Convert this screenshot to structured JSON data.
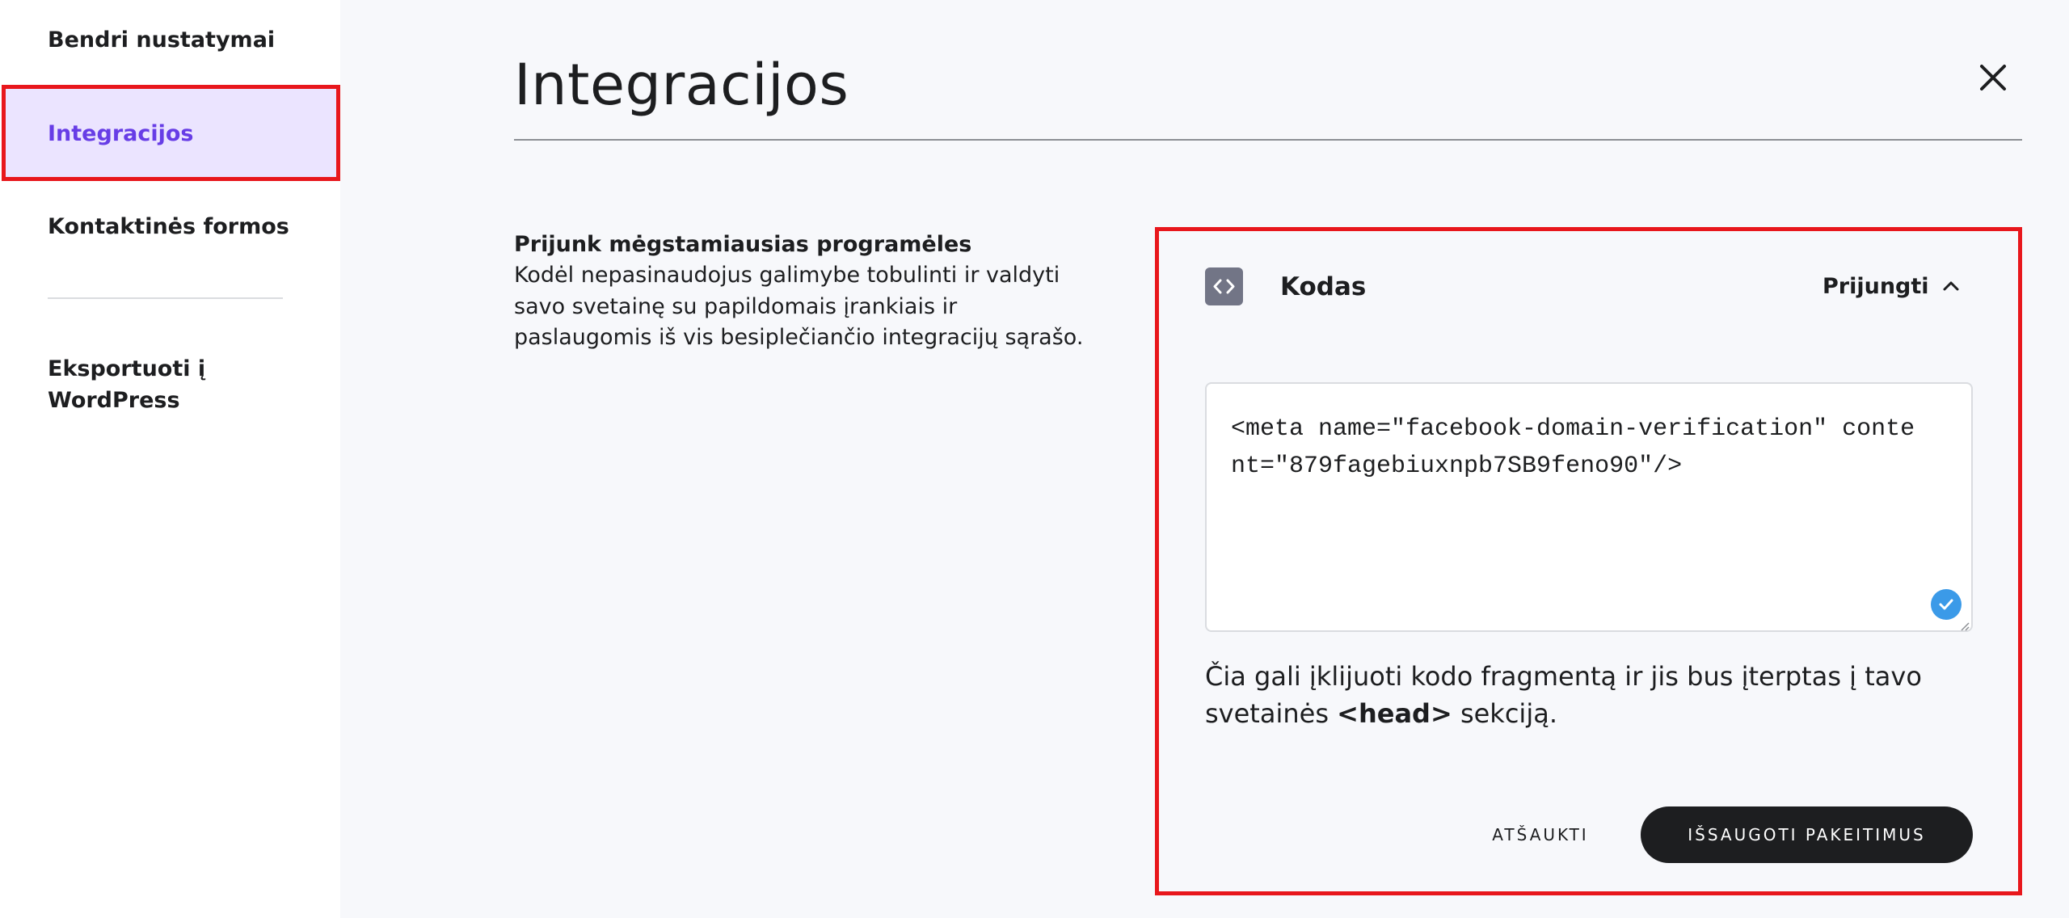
{
  "sidebar": {
    "items": [
      {
        "label": "Bendri nustatymai"
      },
      {
        "label": "Integracijos",
        "active": true
      },
      {
        "label": "Kontaktinės formos"
      },
      {
        "label": "Eksportuoti į WordPress"
      }
    ]
  },
  "header": {
    "title": "Integracijos",
    "close_icon": "close-icon"
  },
  "intro": {
    "heading": "Prijunk mėgstamiausias programėles",
    "body": "Kodėl nepasinaudojus galimybe tobulinti ir valdyti savo svetainę su papildomais įrankiais ir paslaugomis iš vis besiplečiančio integracijų sąrašo."
  },
  "card": {
    "icon": "code-icon",
    "title": "Kodas",
    "connect_label": "Prijungti",
    "code_value": "<meta name=\"facebook-domain-verification\" content=\"879fagebiuxnpb7SB9feno90\"/>",
    "help_before": "Čia gali įklijuoti kodo fragmentą ir jis bus įterptas į tavo svetainės",
    "help_tag": "<head>",
    "help_after": "sekciją.",
    "cancel_label": "ATŠAUKTI",
    "save_label": "IŠSAUGOTI PAKEITIMUS"
  },
  "colors": {
    "accent": "#673de6",
    "active_bg": "#ebe4ff",
    "highlight_border": "#e8171c",
    "check": "#3b9ae8",
    "dark_button": "#1d1e20"
  }
}
